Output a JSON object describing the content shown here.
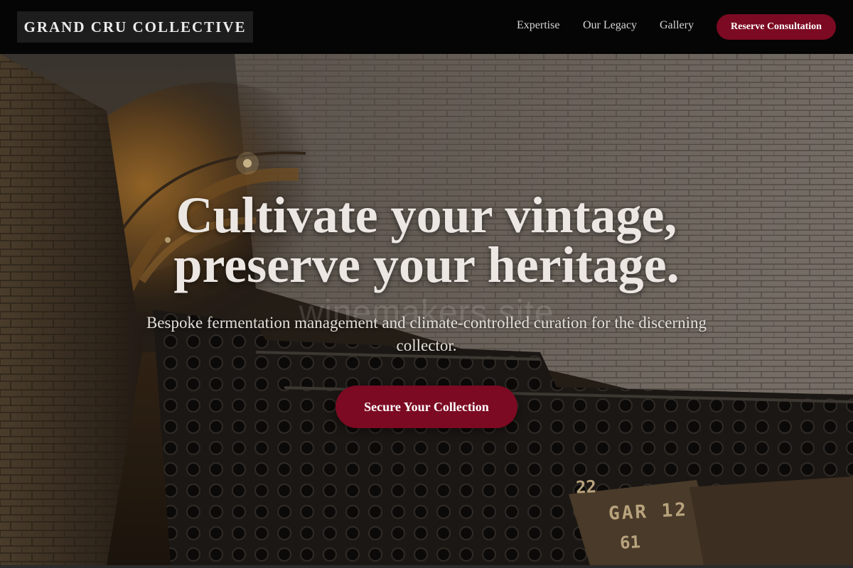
{
  "nav": {
    "brand": "GRAND CRU COLLECTIVE",
    "links": [
      "Expertise",
      "Our Legacy",
      "Gallery"
    ],
    "cta": "Reserve Consultation"
  },
  "hero": {
    "headline_line1": "Cultivate your vintage,",
    "headline_line2": "preserve your heritage.",
    "subtitle": "Bespoke fermentation management and climate-controlled curation for the discerning collector.",
    "cta": "Secure Your Collection",
    "watermark": "winemakers.site",
    "crate_label_top": "22",
    "crate_label_main": "GAR 12",
    "crate_label_sub": "61"
  },
  "colors": {
    "accent": "#7c0a22",
    "nav_bg": "#050505",
    "brand_bg": "#1d1d1d"
  }
}
